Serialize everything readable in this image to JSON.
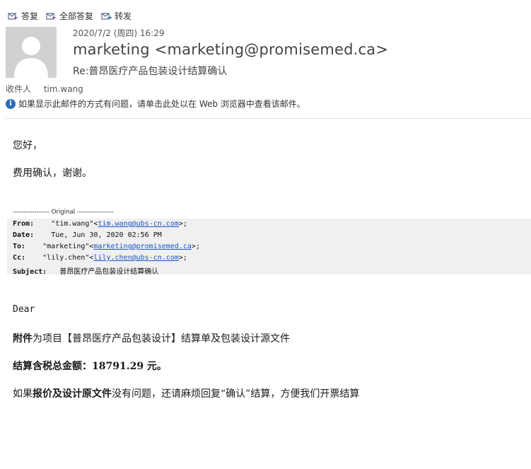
{
  "toolbar": {
    "reply": "答复",
    "reply_all": "全部答复",
    "forward": "转发"
  },
  "email": {
    "date": "2020/7/2 (周四) 16:29",
    "sender": "marketing <marketing@promisemed.ca>",
    "subject": "Re:普昂医疗产品包装设计结算确认",
    "recipient_label": "收件人",
    "recipient": "tim.wang",
    "info_notice": "如果显示此邮件的方式有问题，请单击此处以在 Web 浏览器中查看该邮件。"
  },
  "body": {
    "greeting": "您好，",
    "confirm": "费用确认，谢谢。",
    "original_divider": "----------------- Original -----------------",
    "from_label": "From:",
    "from_name": "\"tim.wang\"<",
    "from_email": "tim.wang@ubs-cn.com",
    "from_tail": ">;",
    "date_label": "Date:",
    "date_value": "Tue, Jun 30, 2020 02:56 PM",
    "to_label": "To:",
    "to_name": "\"marketing\"<",
    "to_email": "marketing@promisemed.ca",
    "to_tail": ">;",
    "cc_label": "Cc:",
    "cc_name": "\"lily.chen\"<",
    "cc_email": "lily.chen@ubs-cn.com",
    "cc_tail": ">;",
    "subject_label": "Subject:",
    "subject_value": "普昂医疗产品包装设计结算确认",
    "dear": "Dear",
    "attach_bold": "附件",
    "attach_rest": "为项目【普昂医疗产品包装设计】结算单及包装设计源文件",
    "total": "结算含税总金额：18791.29 元。",
    "closing_1": "如果",
    "closing_bold": "报价及设计原文件",
    "closing_2": "没有问题，还请麻烦回复“确认”结算，方便我们开票结算"
  }
}
